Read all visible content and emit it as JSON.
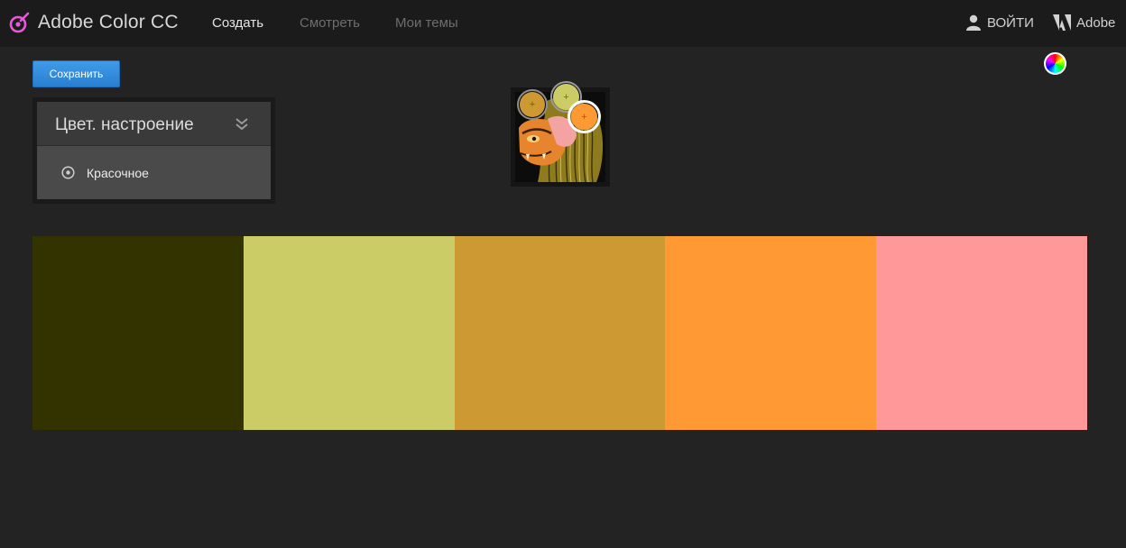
{
  "header": {
    "app_title": "Adobe Color CC",
    "nav": [
      {
        "label": "Создать",
        "active": true
      },
      {
        "label": "Смотреть",
        "active": false
      },
      {
        "label": "Мои темы",
        "active": false
      }
    ],
    "login_label": "ВОЙТИ",
    "adobe_label": "Adobe",
    "logo_color": "#e45bd9"
  },
  "toolbar": {
    "save_label": "Сохранить"
  },
  "mood_panel": {
    "title": "Цвет. настроение",
    "selected_option": "Красочное"
  },
  "image_pickers": [
    {
      "color": "#cc9933"
    },
    {
      "color": "#cccc66"
    },
    {
      "color": "#ff9933"
    }
  ],
  "swatches": [
    {
      "color": "#333300"
    },
    {
      "color": "#cccc66"
    },
    {
      "color": "#cc9933"
    },
    {
      "color": "#ff9933"
    },
    {
      "color": "#ff9999"
    }
  ]
}
